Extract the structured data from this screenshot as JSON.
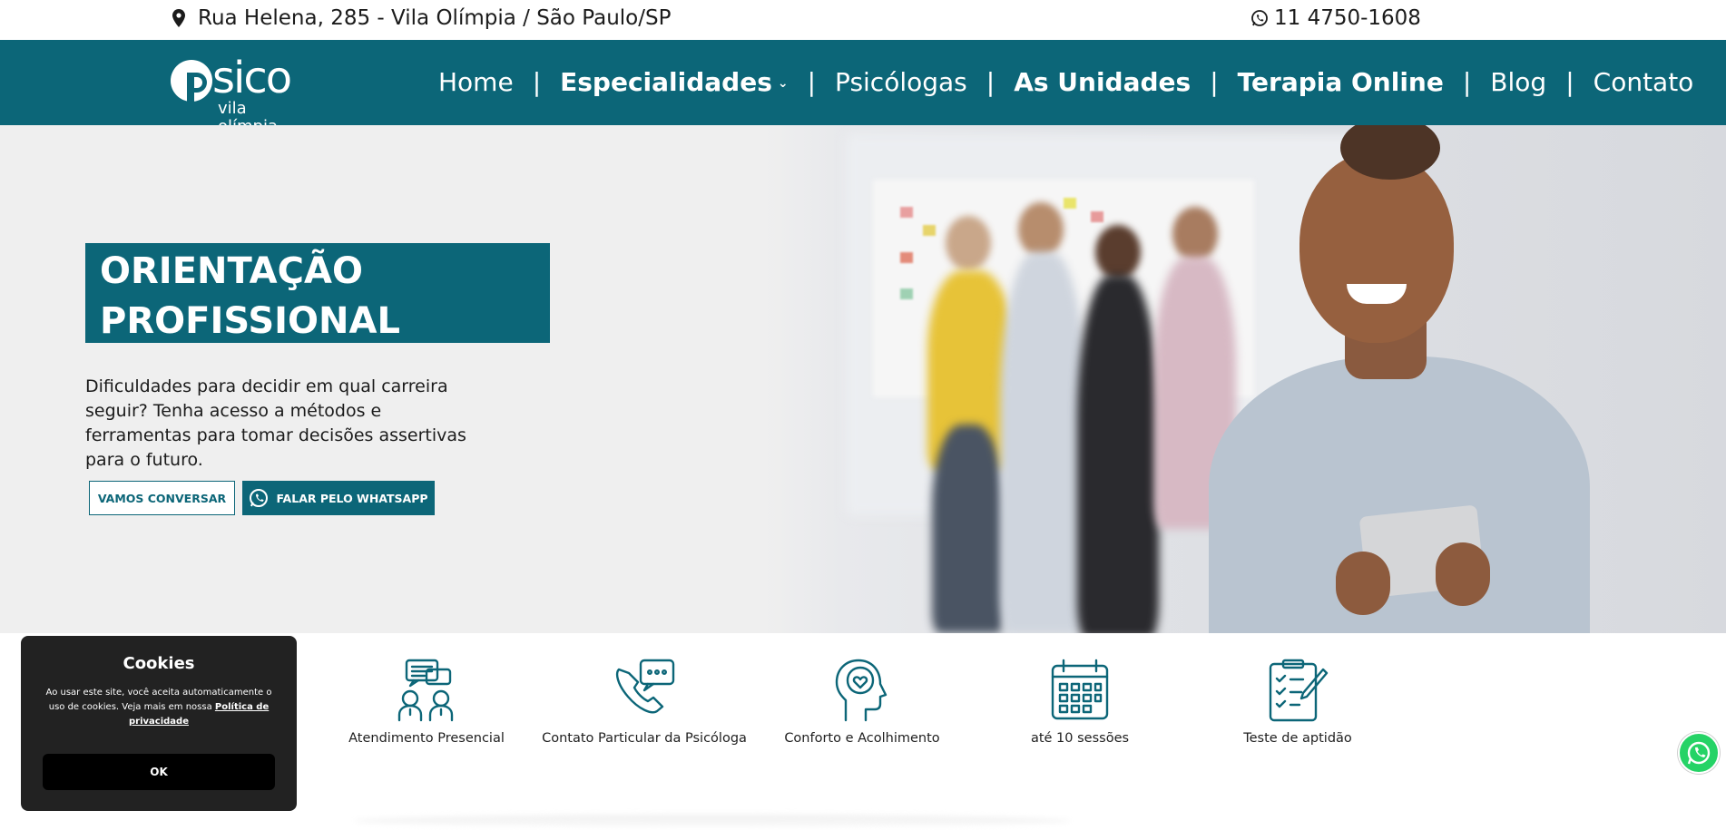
{
  "topbar": {
    "address": "Rua Helena, 285 - Vila Olímpia / São Paulo/SP",
    "phone": "11 4750-1608"
  },
  "logo": {
    "word": "sico",
    "sub": "vila olímpia"
  },
  "nav": {
    "items": [
      {
        "label": "Home"
      },
      {
        "label": "Especialidades"
      },
      {
        "label": "Psicólogas"
      },
      {
        "label": "As Unidades"
      },
      {
        "label": "Terapia Online"
      },
      {
        "label": "Blog"
      },
      {
        "label": "Contato"
      }
    ],
    "separator": "|"
  },
  "hero": {
    "title_line1": "ORIENTAÇÃO",
    "title_line2": "PROFISSIONAL",
    "text": "Dificuldades para decidir em qual carreira seguir? Tenha acesso a métodos e ferramentas para tomar decisões assertivas para o futuro.",
    "btn_contact": "VAMOS CONVERSAR",
    "btn_whatsapp": "FALAR PELO WHATSAPP"
  },
  "features": [
    {
      "label": "Atendimento Presencial",
      "icon": "people-chat-icon"
    },
    {
      "label": "Contato Particular da Psicóloga",
      "icon": "phone-chat-icon"
    },
    {
      "label": "Conforto e Acolhimento",
      "icon": "head-heart-icon"
    },
    {
      "label": "até 10 sessões",
      "icon": "calendar-icon"
    },
    {
      "label": "Teste de aptidão",
      "icon": "checklist-icon"
    }
  ],
  "cookie": {
    "title": "Cookies",
    "text": "Ao usar este site, você aceita automaticamente o uso de cookies. Veja mais em nossa",
    "link": "Política de privacidade",
    "ok": "OK"
  },
  "colors": {
    "brand": "#0c6678",
    "whatsapp": "#25d366"
  }
}
